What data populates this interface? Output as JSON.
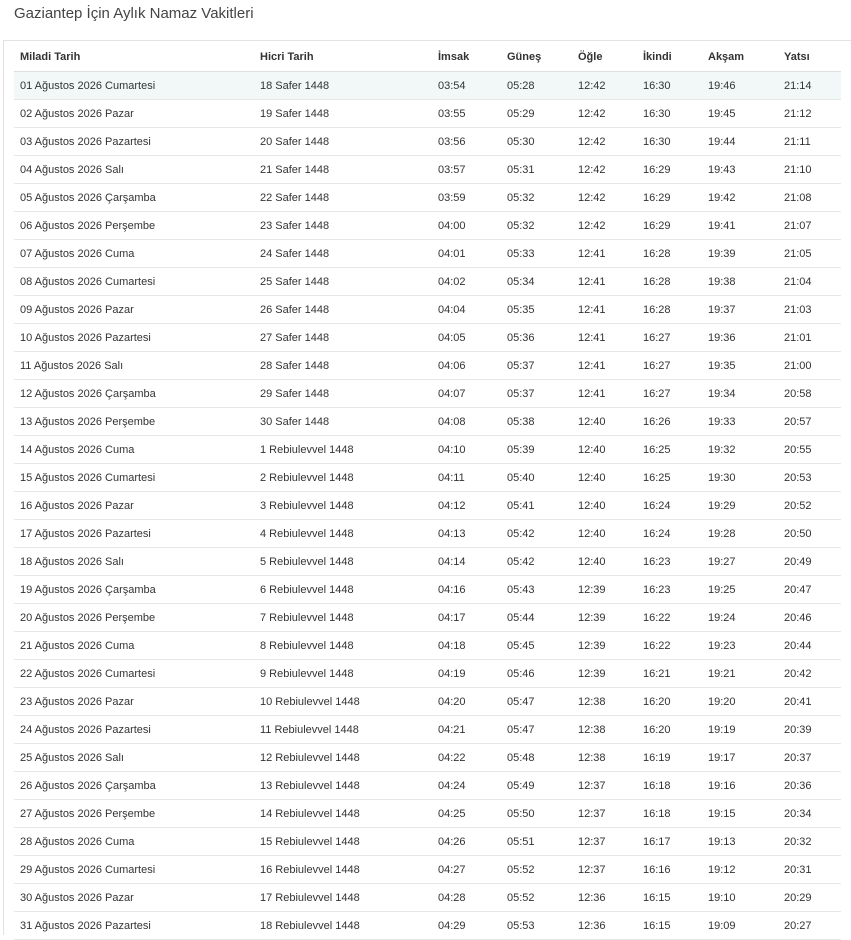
{
  "page": {
    "title": "Gaziantep İçin Aylık Namaz Vakitleri"
  },
  "table": {
    "headers": [
      "Miladi Tarih",
      "Hicri Tarih",
      "İmsak",
      "Güneş",
      "Öğle",
      "İkindi",
      "Akşam",
      "Yatsı"
    ],
    "rows": [
      [
        "01 Ağustos 2026 Cumartesi",
        "18 Safer 1448",
        "03:54",
        "05:28",
        "12:42",
        "16:30",
        "19:46",
        "21:14"
      ],
      [
        "02 Ağustos 2026 Pazar",
        "19 Safer 1448",
        "03:55",
        "05:29",
        "12:42",
        "16:30",
        "19:45",
        "21:12"
      ],
      [
        "03 Ağustos 2026 Pazartesi",
        "20 Safer 1448",
        "03:56",
        "05:30",
        "12:42",
        "16:30",
        "19:44",
        "21:11"
      ],
      [
        "04 Ağustos 2026 Salı",
        "21 Safer 1448",
        "03:57",
        "05:31",
        "12:42",
        "16:29",
        "19:43",
        "21:10"
      ],
      [
        "05 Ağustos 2026 Çarşamba",
        "22 Safer 1448",
        "03:59",
        "05:32",
        "12:42",
        "16:29",
        "19:42",
        "21:08"
      ],
      [
        "06 Ağustos 2026 Perşembe",
        "23 Safer 1448",
        "04:00",
        "05:32",
        "12:42",
        "16:29",
        "19:41",
        "21:07"
      ],
      [
        "07 Ağustos 2026 Cuma",
        "24 Safer 1448",
        "04:01",
        "05:33",
        "12:41",
        "16:28",
        "19:39",
        "21:05"
      ],
      [
        "08 Ağustos 2026 Cumartesi",
        "25 Safer 1448",
        "04:02",
        "05:34",
        "12:41",
        "16:28",
        "19:38",
        "21:04"
      ],
      [
        "09 Ağustos 2026 Pazar",
        "26 Safer 1448",
        "04:04",
        "05:35",
        "12:41",
        "16:28",
        "19:37",
        "21:03"
      ],
      [
        "10 Ağustos 2026 Pazartesi",
        "27 Safer 1448",
        "04:05",
        "05:36",
        "12:41",
        "16:27",
        "19:36",
        "21:01"
      ],
      [
        "11 Ağustos 2026 Salı",
        "28 Safer 1448",
        "04:06",
        "05:37",
        "12:41",
        "16:27",
        "19:35",
        "21:00"
      ],
      [
        "12 Ağustos 2026 Çarşamba",
        "29 Safer 1448",
        "04:07",
        "05:37",
        "12:41",
        "16:27",
        "19:34",
        "20:58"
      ],
      [
        "13 Ağustos 2026 Perşembe",
        "30 Safer 1448",
        "04:08",
        "05:38",
        "12:40",
        "16:26",
        "19:33",
        "20:57"
      ],
      [
        "14 Ağustos 2026 Cuma",
        "1 Rebiulevvel 1448",
        "04:10",
        "05:39",
        "12:40",
        "16:25",
        "19:32",
        "20:55"
      ],
      [
        "15 Ağustos 2026 Cumartesi",
        "2 Rebiulevvel 1448",
        "04:11",
        "05:40",
        "12:40",
        "16:25",
        "19:30",
        "20:53"
      ],
      [
        "16 Ağustos 2026 Pazar",
        "3 Rebiulevvel 1448",
        "04:12",
        "05:41",
        "12:40",
        "16:24",
        "19:29",
        "20:52"
      ],
      [
        "17 Ağustos 2026 Pazartesi",
        "4 Rebiulevvel 1448",
        "04:13",
        "05:42",
        "12:40",
        "16:24",
        "19:28",
        "20:50"
      ],
      [
        "18 Ağustos 2026 Salı",
        "5 Rebiulevvel 1448",
        "04:14",
        "05:42",
        "12:40",
        "16:23",
        "19:27",
        "20:49"
      ],
      [
        "19 Ağustos 2026 Çarşamba",
        "6 Rebiulevvel 1448",
        "04:16",
        "05:43",
        "12:39",
        "16:23",
        "19:25",
        "20:47"
      ],
      [
        "20 Ağustos 2026 Perşembe",
        "7 Rebiulevvel 1448",
        "04:17",
        "05:44",
        "12:39",
        "16:22",
        "19:24",
        "20:46"
      ],
      [
        "21 Ağustos 2026 Cuma",
        "8 Rebiulevvel 1448",
        "04:18",
        "05:45",
        "12:39",
        "16:22",
        "19:23",
        "20:44"
      ],
      [
        "22 Ağustos 2026 Cumartesi",
        "9 Rebiulevvel 1448",
        "04:19",
        "05:46",
        "12:39",
        "16:21",
        "19:21",
        "20:42"
      ],
      [
        "23 Ağustos 2026 Pazar",
        "10 Rebiulevvel 1448",
        "04:20",
        "05:47",
        "12:38",
        "16:20",
        "19:20",
        "20:41"
      ],
      [
        "24 Ağustos 2026 Pazartesi",
        "11 Rebiulevvel 1448",
        "04:21",
        "05:47",
        "12:38",
        "16:20",
        "19:19",
        "20:39"
      ],
      [
        "25 Ağustos 2026 Salı",
        "12 Rebiulevvel 1448",
        "04:22",
        "05:48",
        "12:38",
        "16:19",
        "19:17",
        "20:37"
      ],
      [
        "26 Ağustos 2026 Çarşamba",
        "13 Rebiulevvel 1448",
        "04:24",
        "05:49",
        "12:37",
        "16:18",
        "19:16",
        "20:36"
      ],
      [
        "27 Ağustos 2026 Perşembe",
        "14 Rebiulevvel 1448",
        "04:25",
        "05:50",
        "12:37",
        "16:18",
        "19:15",
        "20:34"
      ],
      [
        "28 Ağustos 2026 Cuma",
        "15 Rebiulevvel 1448",
        "04:26",
        "05:51",
        "12:37",
        "16:17",
        "19:13",
        "20:32"
      ],
      [
        "29 Ağustos 2026 Cumartesi",
        "16 Rebiulevvel 1448",
        "04:27",
        "05:52",
        "12:37",
        "16:16",
        "19:12",
        "20:31"
      ],
      [
        "30 Ağustos 2026 Pazar",
        "17 Rebiulevvel 1448",
        "04:28",
        "05:52",
        "12:36",
        "16:15",
        "19:10",
        "20:29"
      ],
      [
        "31 Ağustos 2026 Pazartesi",
        "18 Rebiulevvel 1448",
        "04:29",
        "05:53",
        "12:36",
        "16:15",
        "19:09",
        "20:27"
      ]
    ]
  }
}
